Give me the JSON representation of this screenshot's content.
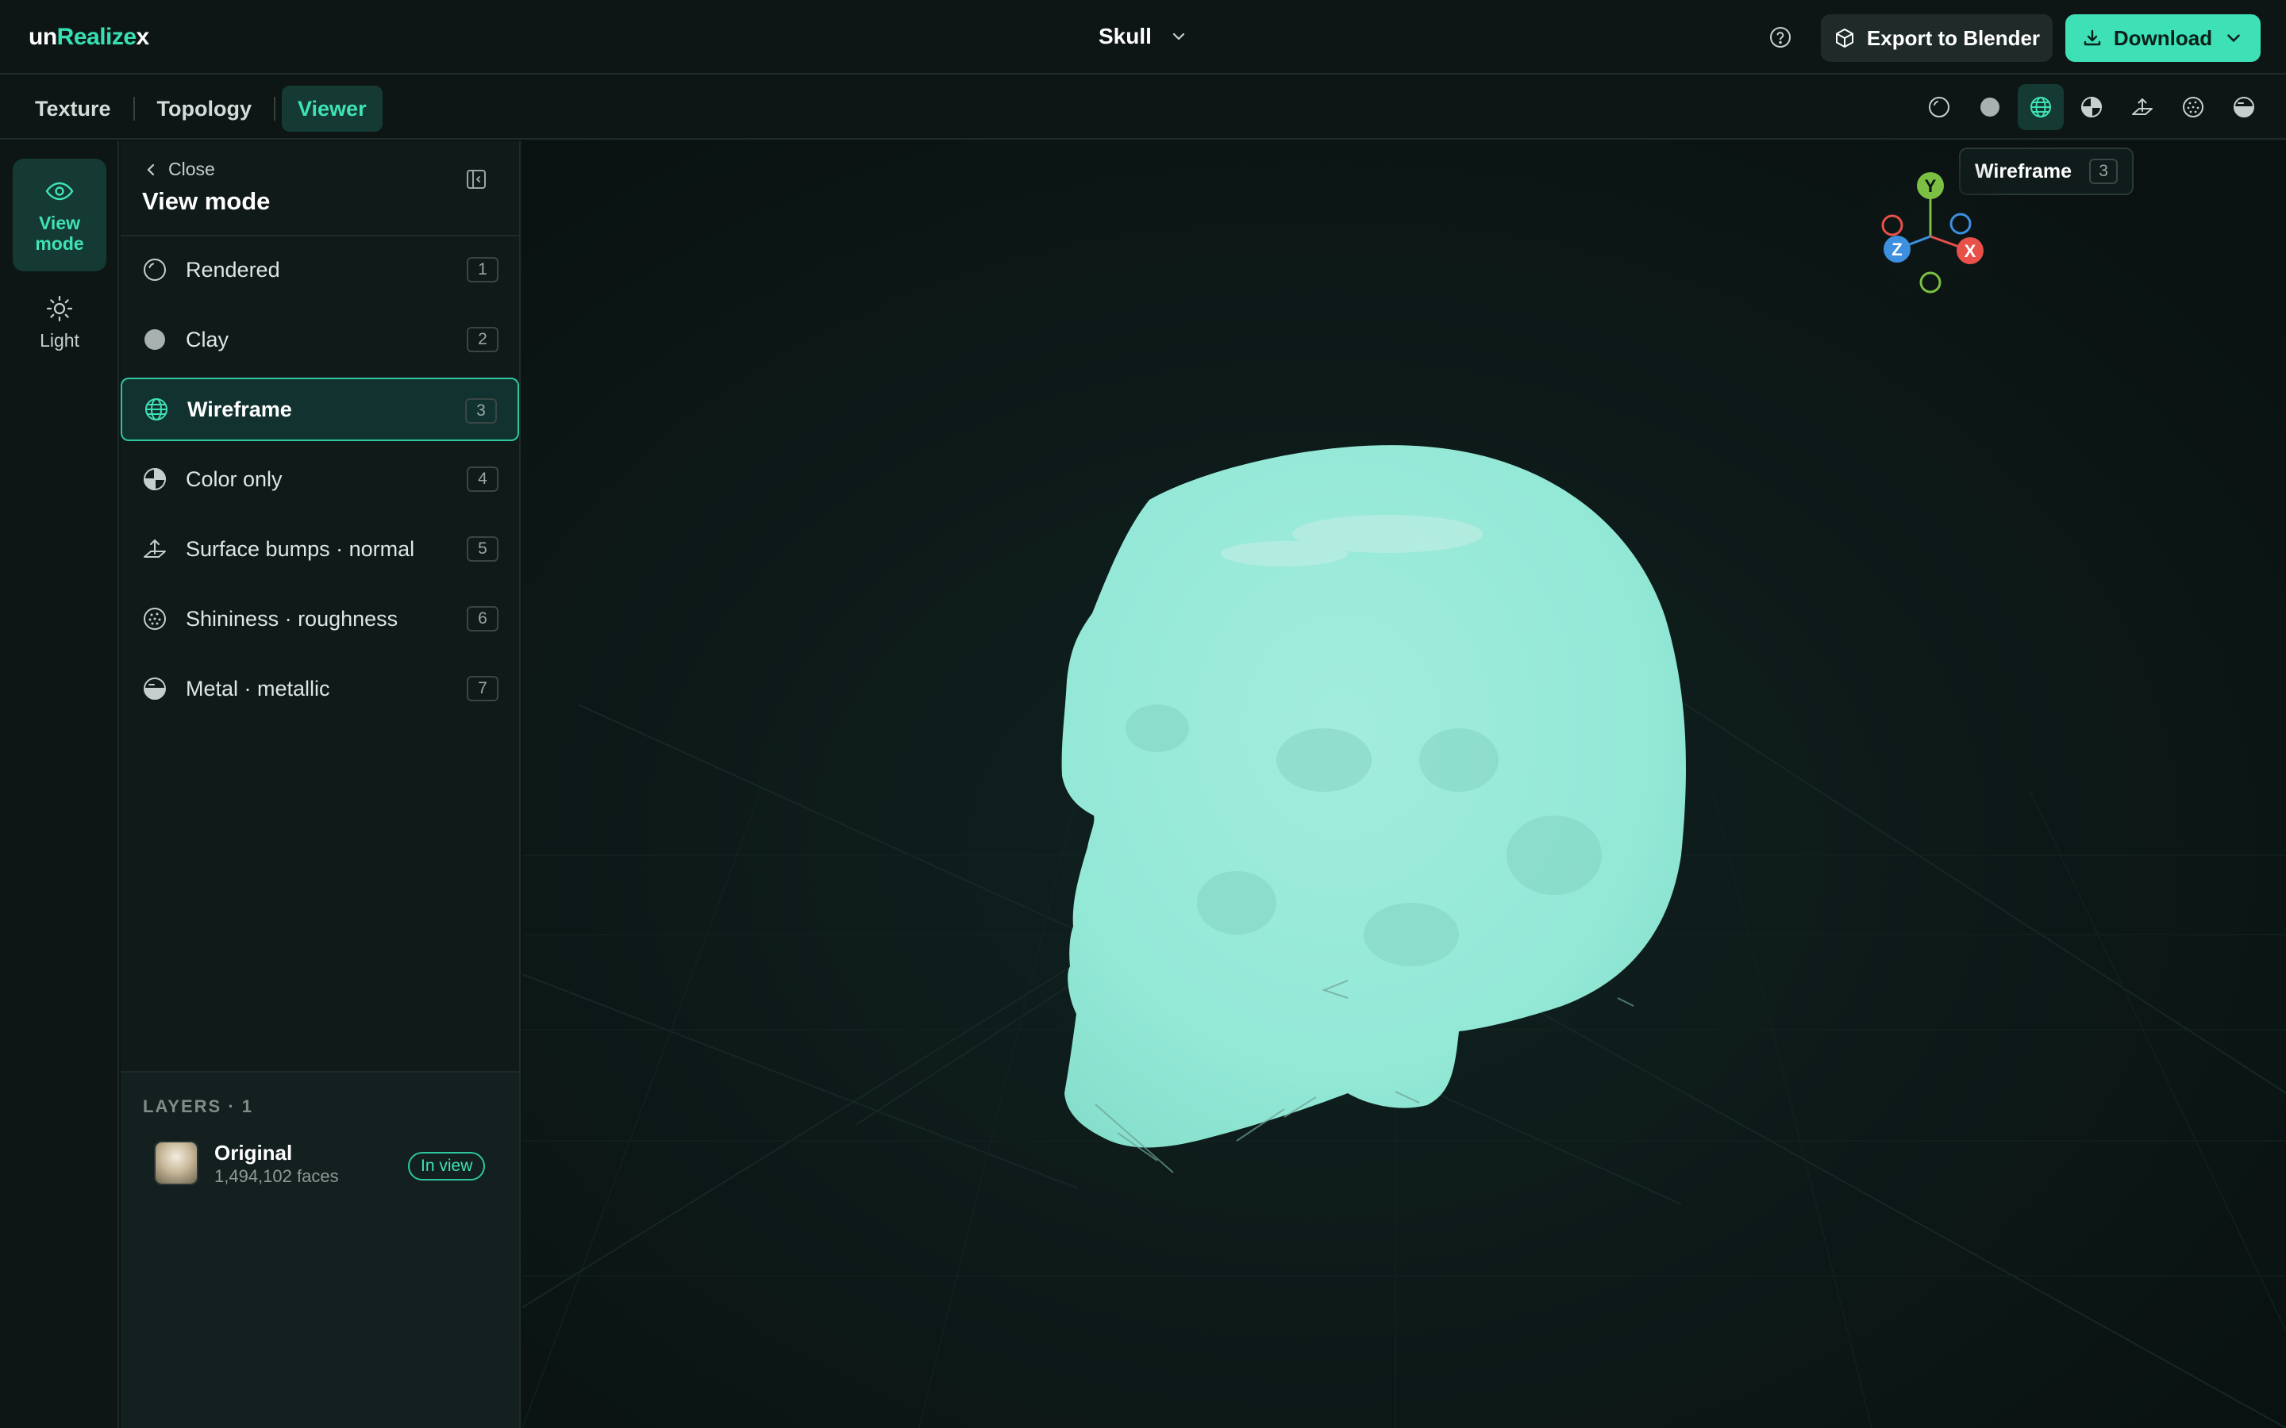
{
  "app": {
    "logo_part1": "un",
    "logo_part2": "Realize",
    "logo_part3": "x",
    "project_name": "Skull"
  },
  "header": {
    "export_label": "Export to Blender",
    "download_label": "Download"
  },
  "tabs": [
    {
      "label": "Texture",
      "active": false
    },
    {
      "label": "Topology",
      "active": false
    },
    {
      "label": "Viewer",
      "active": true
    }
  ],
  "toolbar_modes": [
    "rendered-icon",
    "clay-icon",
    "wireframe-icon",
    "color-only-icon",
    "surface-bumps-icon",
    "shininess-icon",
    "metal-icon"
  ],
  "rail": {
    "view_mode_label": "View mode",
    "light_label": "Light"
  },
  "panel": {
    "close_label": "Close",
    "title": "View mode",
    "modes": [
      {
        "label": "Rendered",
        "key": "1",
        "icon": "rendered-icon"
      },
      {
        "label": "Clay",
        "key": "2",
        "icon": "clay-icon"
      },
      {
        "label": "Wireframe",
        "key": "3",
        "icon": "wireframe-icon",
        "selected": true
      },
      {
        "label": "Color only",
        "key": "4",
        "icon": "color-only-icon"
      },
      {
        "label": "Surface bumps · normal",
        "key": "5",
        "icon": "surface-bumps-icon"
      },
      {
        "label": "Shininess · roughness",
        "key": "6",
        "icon": "shininess-icon"
      },
      {
        "label": "Metal · metallic",
        "key": "7",
        "icon": "metal-icon"
      }
    ]
  },
  "layers": {
    "title": "LAYERS · 1",
    "items": [
      {
        "name": "Original",
        "faces": "1,494,102 faces",
        "badge": "In view"
      }
    ]
  },
  "tooltip": {
    "label": "Wireframe",
    "key": "3"
  },
  "gizmo": {
    "y": "Y",
    "x": "X",
    "z": "Z"
  },
  "colors": {
    "accent": "#3ee0b6",
    "model": "#93e8d6",
    "axis_x": "#e8504a",
    "axis_y": "#7bc043",
    "axis_z": "#3d8fe0"
  }
}
